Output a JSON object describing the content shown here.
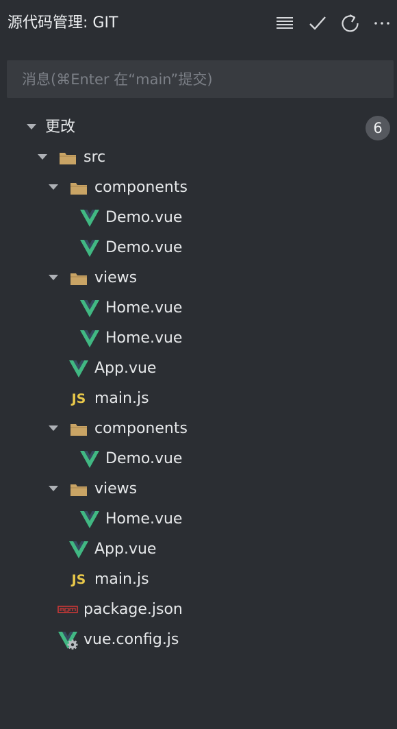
{
  "header": {
    "title": "源代码管理: GIT",
    "icons": [
      "list-view-icon",
      "check-icon",
      "refresh-icon",
      "more-icon"
    ]
  },
  "commit": {
    "placeholder": "消息(⌘Enter 在“main”提交)",
    "value": ""
  },
  "changes": {
    "label": "更改",
    "count": "6"
  },
  "tree": [
    {
      "label": "src",
      "type": "folder",
      "depth": 1,
      "expanded": true
    },
    {
      "label": "components",
      "type": "folder",
      "depth": 2,
      "expanded": true
    },
    {
      "label": "Demo.vue",
      "type": "vue",
      "depth": 3
    },
    {
      "label": "Demo.vue",
      "type": "vue",
      "depth": 3
    },
    {
      "label": "views",
      "type": "folder",
      "depth": 2,
      "expanded": true
    },
    {
      "label": "Home.vue",
      "type": "vue",
      "depth": 3
    },
    {
      "label": "Home.vue",
      "type": "vue",
      "depth": 3
    },
    {
      "label": "App.vue",
      "type": "vue",
      "depth": 2
    },
    {
      "label": "main.js",
      "type": "js",
      "depth": 2
    },
    {
      "label": "components",
      "type": "folder",
      "depth": 2,
      "expanded": true
    },
    {
      "label": "Demo.vue",
      "type": "vue",
      "depth": 3
    },
    {
      "label": "views",
      "type": "folder",
      "depth": 2,
      "expanded": true
    },
    {
      "label": "Home.vue",
      "type": "vue",
      "depth": 3
    },
    {
      "label": "App.vue",
      "type": "vue",
      "depth": 2
    },
    {
      "label": "main.js",
      "type": "js",
      "depth": 2
    },
    {
      "label": "package.json",
      "type": "npm",
      "depth": 1
    },
    {
      "label": "vue.config.js",
      "type": "vue-config",
      "depth": 1
    }
  ],
  "colors": {
    "background": "#2b2e33",
    "input_background": "#383b40",
    "folder": "#c9a465",
    "vue_green": "#41b883",
    "vue_dark": "#35495e",
    "js_yellow": "#e8c84a",
    "npm_red": "#cb3837",
    "badge": "#55585e"
  }
}
